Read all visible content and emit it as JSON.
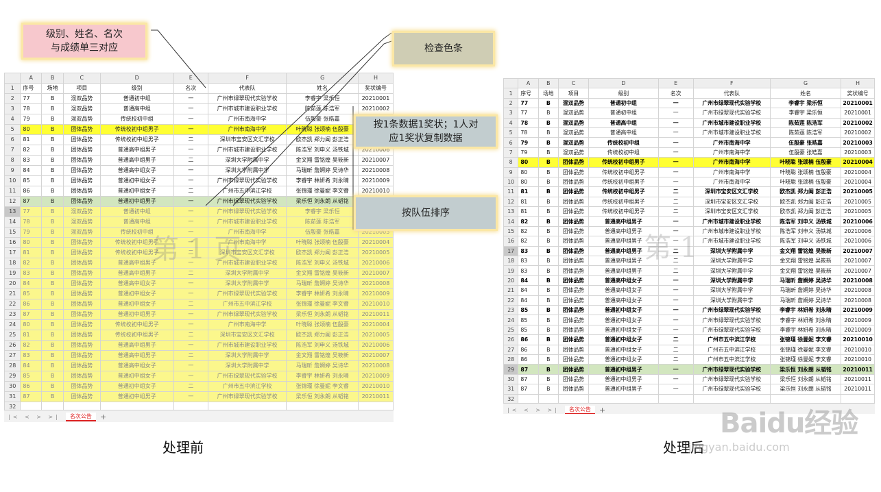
{
  "columns": [
    "A",
    "B",
    "C",
    "D",
    "E",
    "F",
    "G",
    "H"
  ],
  "header_row": [
    "序号",
    "场地",
    "项目",
    "级别",
    "名次",
    "代表队",
    "姓名",
    "奖状编号"
  ],
  "before": {
    "caption": "处理前",
    "sheet_tab": "名次公告",
    "watermark": "第 1 页",
    "rows": [
      {
        "n": "1",
        "c": [
          "序号",
          "场地",
          "项目",
          "级别",
          "名次",
          "代表队",
          "姓名",
          "奖状编号"
        ],
        "s": "hdr"
      },
      {
        "n": "2",
        "c": [
          "77",
          "B",
          "混双品势",
          "普通初中组",
          "一",
          "广州市绿翠现代实验学校",
          "李睿宇 梁乐恒",
          "20210001"
        ],
        "s": ""
      },
      {
        "n": "3",
        "c": [
          "78",
          "B",
          "混双品势",
          "普通高中组",
          "一",
          "广州市城市建设职业学校",
          "陈茹莲 陈浩军",
          "20210002"
        ],
        "s": ""
      },
      {
        "n": "4",
        "c": [
          "79",
          "B",
          "混双品势",
          "传统校初中组",
          "一",
          "广州市南海中学",
          "伍殷豪 张皓嘉",
          "20210003"
        ],
        "s": ""
      },
      {
        "n": "5",
        "c": [
          "80",
          "B",
          "团体品势",
          "传统校初中组男子",
          "一",
          "广州市南海中学",
          "叶晓聪 张颂楠 伍殷豪",
          "20210004"
        ],
        "s": "yellow"
      },
      {
        "n": "6",
        "c": [
          "81",
          "B",
          "团体品势",
          "传统校初中组男子",
          "二",
          "深圳市宝安区文汇学校",
          "欧杰凯 郑力阖 彭正浩",
          "20210005"
        ],
        "s": ""
      },
      {
        "n": "7",
        "c": [
          "82",
          "B",
          "团体品势",
          "普通高中组男子",
          "一",
          "广州市城市建设职业学校",
          "陈浩军 刘申义 汤铁城",
          "20210006"
        ],
        "s": ""
      },
      {
        "n": "8",
        "c": [
          "83",
          "B",
          "团体品势",
          "普通高中组男子",
          "二",
          "深圳大学附属中学",
          "金文翔 雷铭煌 吴筱新",
          "20210007"
        ],
        "s": ""
      },
      {
        "n": "9",
        "c": [
          "84",
          "B",
          "团体品势",
          "普通高中组女子",
          "一",
          "深圳大学附属中学",
          "马瑞昕 詹婀婷 吴诗华",
          "20210008"
        ],
        "s": ""
      },
      {
        "n": "10",
        "c": [
          "85",
          "B",
          "团体品势",
          "普通初中组女子",
          "一",
          "广州市绿翠现代实验学校",
          "李睿宇 林妍希 刘永晴",
          "20210009"
        ],
        "s": ""
      },
      {
        "n": "11",
        "c": [
          "86",
          "B",
          "团体品势",
          "普通初中组女子",
          "二",
          "广州市五中滨江学校",
          "张锦瑾 徐曼妮 李文睿",
          "20210010"
        ],
        "s": ""
      },
      {
        "n": "12",
        "c": [
          "87",
          "B",
          "团体品势",
          "普通初中组男子",
          "一",
          "广州市绿翠现代实验学校",
          "梁乐恒 刘永朗 从韬铭",
          "20210011"
        ],
        "s": "green"
      },
      {
        "n": "13",
        "c": [
          "77",
          "B",
          "混双品势",
          "普通初中组",
          "一",
          "广州市绿翠现代实验学校",
          "李睿宇 梁乐恒",
          "20210001"
        ],
        "s": "faded sel"
      },
      {
        "n": "14",
        "c": [
          "78",
          "B",
          "混双品势",
          "普通高中组",
          "一",
          "广州市城市建设职业学校",
          "陈茹莲 陈浩军",
          "20210002"
        ],
        "s": "faded"
      },
      {
        "n": "15",
        "c": [
          "79",
          "B",
          "混双品势",
          "传统校初中组",
          "一",
          "广州市南海中学",
          "伍殷豪 张皓嘉",
          "20210003"
        ],
        "s": "faded"
      },
      {
        "n": "16",
        "c": [
          "80",
          "B",
          "团体品势",
          "传统校初中组男子",
          "一",
          "广州市南海中学",
          "叶晓聪 张颂楠 伍殷豪",
          "20210004"
        ],
        "s": "faded"
      },
      {
        "n": "17",
        "c": [
          "81",
          "B",
          "团体品势",
          "传统校初中组男子",
          "二",
          "深圳市宝安区文汇学校",
          "欧杰凯 郑力阖 彭正浩",
          "20210005"
        ],
        "s": "faded"
      },
      {
        "n": "18",
        "c": [
          "82",
          "B",
          "团体品势",
          "普通高中组男子",
          "一",
          "广州市城市建设职业学校",
          "陈浩军 刘申义 汤铁城",
          "20210006"
        ],
        "s": "faded"
      },
      {
        "n": "19",
        "c": [
          "83",
          "B",
          "团体品势",
          "普通高中组男子",
          "二",
          "深圳大学附属中学",
          "金文翔 雷铭煌 吴筱新",
          "20210007"
        ],
        "s": "faded"
      },
      {
        "n": "20",
        "c": [
          "84",
          "B",
          "团体品势",
          "普通高中组女子",
          "一",
          "深圳大学附属中学",
          "马瑞昕 詹婀婷 吴诗华",
          "20210008"
        ],
        "s": "faded"
      },
      {
        "n": "21",
        "c": [
          "85",
          "B",
          "团体品势",
          "普通初中组女子",
          "一",
          "广州市绿翠现代实验学校",
          "李睿宇 林妍希 刘永晴",
          "20210009"
        ],
        "s": "faded"
      },
      {
        "n": "22",
        "c": [
          "86",
          "B",
          "团体品势",
          "普通初中组女子",
          "二",
          "广州市五中滨江学校",
          "张锦瑾 徐曼妮 李文睿",
          "20210010"
        ],
        "s": "faded"
      },
      {
        "n": "23",
        "c": [
          "87",
          "B",
          "团体品势",
          "普通初中组男子",
          "一",
          "广州市绿翠现代实验学校",
          "梁乐恒 刘永朗 从韬铭",
          "20210011"
        ],
        "s": "faded"
      },
      {
        "n": "24",
        "c": [
          "80",
          "B",
          "团体品势",
          "传统校初中组男子",
          "一",
          "广州市南海中学",
          "叶晓聪 张颂楠 伍殷豪",
          "20210004"
        ],
        "s": "faded"
      },
      {
        "n": "25",
        "c": [
          "81",
          "B",
          "团体品势",
          "传统校初中组男子",
          "二",
          "深圳市宝安区文汇学校",
          "欧杰凯 郑力阖 彭正浩",
          "20210005"
        ],
        "s": "faded"
      },
      {
        "n": "26",
        "c": [
          "82",
          "B",
          "团体品势",
          "普通高中组男子",
          "一",
          "广州市城市建设职业学校",
          "陈浩军 刘申义 汤铁城",
          "20210006"
        ],
        "s": "faded"
      },
      {
        "n": "27",
        "c": [
          "83",
          "B",
          "团体品势",
          "普通高中组男子",
          "二",
          "深圳大学附属中学",
          "金文翔 雷铭煌 吴筱新",
          "20210007"
        ],
        "s": "faded"
      },
      {
        "n": "28",
        "c": [
          "84",
          "B",
          "团体品势",
          "普通高中组女子",
          "一",
          "深圳大学附属中学",
          "马瑞昕 詹婀婷 吴诗华",
          "20210008"
        ],
        "s": "faded"
      },
      {
        "n": "29",
        "c": [
          "85",
          "B",
          "团体品势",
          "普通初中组女子",
          "一",
          "广州市绿翠现代实验学校",
          "李睿宇 林妍希 刘永晴",
          "20210009"
        ],
        "s": "faded"
      },
      {
        "n": "30",
        "c": [
          "86",
          "B",
          "团体品势",
          "普通初中组女子",
          "二",
          "广州市五中滨江学校",
          "张锦瑾 徐曼妮 李文睿",
          "20210010"
        ],
        "s": "faded"
      },
      {
        "n": "31",
        "c": [
          "87",
          "B",
          "团体品势",
          "普通初中组男子",
          "一",
          "广州市绿翠现代实验学校",
          "梁乐恒 刘永朗 从韬铭",
          "20210011"
        ],
        "s": "faded"
      },
      {
        "n": "32",
        "c": [
          "",
          "",
          "",
          "",
          "",
          "",
          "",
          ""
        ],
        "s": "empty"
      }
    ]
  },
  "after": {
    "caption": "处理后",
    "sheet_tab": "名次公告",
    "watermark": "第 1",
    "rows": [
      {
        "n": "1",
        "c": [
          "序号",
          "场地",
          "项目",
          "级别",
          "名次",
          "代表队",
          "姓名",
          "奖状编号"
        ],
        "s": "hdr"
      },
      {
        "n": "2",
        "c": [
          "77",
          "B",
          "混双品势",
          "普通初中组",
          "一",
          "广州市绿翠现代实验学校",
          "李睿宇 梁乐恒",
          "20210001"
        ],
        "s": "bold"
      },
      {
        "n": "3",
        "c": [
          "77",
          "B",
          "混双品势",
          "普通初中组",
          "一",
          "广州市绿翠现代实验学校",
          "李睿宇 梁乐恒",
          "20210001"
        ],
        "s": ""
      },
      {
        "n": "4",
        "c": [
          "78",
          "B",
          "混双品势",
          "普通高中组",
          "一",
          "广州市城市建设职业学校",
          "陈茹莲 陈浩军",
          "20210002"
        ],
        "s": "bold"
      },
      {
        "n": "5",
        "c": [
          "78",
          "B",
          "混双品势",
          "普通高中组",
          "一",
          "广州市城市建设职业学校",
          "陈茹莲 陈浩军",
          "20210002"
        ],
        "s": ""
      },
      {
        "n": "6",
        "c": [
          "79",
          "B",
          "混双品势",
          "传统校初中组",
          "一",
          "广州市南海中学",
          "伍殷豪 张皓嘉",
          "20210003"
        ],
        "s": "bold"
      },
      {
        "n": "7",
        "c": [
          "79",
          "B",
          "混双品势",
          "传统校初中组",
          "一",
          "广州市南海中学",
          "伍殷豪 张皓嘉",
          "20210003"
        ],
        "s": ""
      },
      {
        "n": "8",
        "c": [
          "80",
          "B",
          "团体品势",
          "传统校初中组男子",
          "一",
          "广州市南海中学",
          "叶晓聪 张颂楠 伍殷豪",
          "20210004"
        ],
        "s": "yellow bold"
      },
      {
        "n": "9",
        "c": [
          "80",
          "B",
          "团体品势",
          "传统校初中组男子",
          "一",
          "广州市南海中学",
          "叶晓聪 张颂楠 伍殷豪",
          "20210004"
        ],
        "s": ""
      },
      {
        "n": "10",
        "c": [
          "80",
          "B",
          "团体品势",
          "传统校初中组男子",
          "一",
          "广州市南海中学",
          "叶晓聪 张颂楠 伍殷豪",
          "20210004"
        ],
        "s": ""
      },
      {
        "n": "11",
        "c": [
          "81",
          "B",
          "团体品势",
          "传统校初中组男子",
          "二",
          "深圳市宝安区文汇学校",
          "欧杰凯 郑力阖 彭正浩",
          "20210005"
        ],
        "s": "bold"
      },
      {
        "n": "12",
        "c": [
          "81",
          "B",
          "团体品势",
          "传统校初中组男子",
          "二",
          "深圳市宝安区文汇学校",
          "欧杰凯 郑力阖 彭正浩",
          "20210005"
        ],
        "s": ""
      },
      {
        "n": "13",
        "c": [
          "81",
          "B",
          "团体品势",
          "传统校初中组男子",
          "二",
          "深圳市宝安区文汇学校",
          "欧杰凯 郑力阖 彭正浩",
          "20210005"
        ],
        "s": ""
      },
      {
        "n": "14",
        "c": [
          "82",
          "B",
          "团体品势",
          "普通高中组男子",
          "一",
          "广州市城市建设职业学校",
          "陈浩军 刘申义 汤铁城",
          "20210006"
        ],
        "s": "bold"
      },
      {
        "n": "15",
        "c": [
          "82",
          "B",
          "团体品势",
          "普通高中组男子",
          "一",
          "广州市城市建设职业学校",
          "陈浩军 刘申义 汤铁城",
          "20210006"
        ],
        "s": ""
      },
      {
        "n": "16",
        "c": [
          "82",
          "B",
          "团体品势",
          "普通高中组男子",
          "一",
          "广州市城市建设职业学校",
          "陈浩军 刘申义 汤铁城",
          "20210006"
        ],
        "s": ""
      },
      {
        "n": "17",
        "c": [
          "83",
          "B",
          "团体品势",
          "普通高中组男子",
          "二",
          "深圳大学附属中学",
          "金文翔 雷铭煌 吴筱新",
          "20210007"
        ],
        "s": "bold sel"
      },
      {
        "n": "18",
        "c": [
          "83",
          "B",
          "团体品势",
          "普通高中组男子",
          "二",
          "深圳大学附属中学",
          "金文翔 雷铭煌 吴筱新",
          "20210007"
        ],
        "s": ""
      },
      {
        "n": "19",
        "c": [
          "83",
          "B",
          "团体品势",
          "普通高中组男子",
          "二",
          "深圳大学附属中学",
          "金文翔 雷铭煌 吴筱新",
          "20210007"
        ],
        "s": ""
      },
      {
        "n": "20",
        "c": [
          "84",
          "B",
          "团体品势",
          "普通高中组女子",
          "一",
          "深圳大学附属中学",
          "马瑞昕 詹婀婷 吴诗华",
          "20210008"
        ],
        "s": "bold"
      },
      {
        "n": "21",
        "c": [
          "84",
          "B",
          "团体品势",
          "普通高中组女子",
          "一",
          "深圳大学附属中学",
          "马瑞昕 詹婀婷 吴诗华",
          "20210008"
        ],
        "s": ""
      },
      {
        "n": "22",
        "c": [
          "84",
          "B",
          "团体品势",
          "普通高中组女子",
          "一",
          "深圳大学附属中学",
          "马瑞昕 詹婀婷 吴诗华",
          "20210008"
        ],
        "s": ""
      },
      {
        "n": "23",
        "c": [
          "85",
          "B",
          "团体品势",
          "普通初中组女子",
          "一",
          "广州市绿翠现代实验学校",
          "李睿宇 林妍希 刘永晴",
          "20210009"
        ],
        "s": "bold"
      },
      {
        "n": "24",
        "c": [
          "85",
          "B",
          "团体品势",
          "普通初中组女子",
          "一",
          "广州市绿翠现代实验学校",
          "李睿宇 林妍希 刘永晴",
          "20210009"
        ],
        "s": ""
      },
      {
        "n": "25",
        "c": [
          "85",
          "B",
          "团体品势",
          "普通初中组女子",
          "一",
          "广州市绿翠现代实验学校",
          "李睿宇 林妍希 刘永晴",
          "20210009"
        ],
        "s": ""
      },
      {
        "n": "26",
        "c": [
          "86",
          "B",
          "团体品势",
          "普通初中组女子",
          "二",
          "广州市五中滨江学校",
          "张锦瑾 徐曼妮 李文睿",
          "20210010"
        ],
        "s": "bold"
      },
      {
        "n": "27",
        "c": [
          "86",
          "B",
          "团体品势",
          "普通初中组女子",
          "二",
          "广州市五中滨江学校",
          "张锦瑾 徐曼妮 李文睿",
          "20210010"
        ],
        "s": ""
      },
      {
        "n": "28",
        "c": [
          "86",
          "B",
          "团体品势",
          "普通初中组女子",
          "二",
          "广州市五中滨江学校",
          "张锦瑾 徐曼妮 李文睿",
          "20210010"
        ],
        "s": ""
      },
      {
        "n": "29",
        "c": [
          "87",
          "B",
          "团体品势",
          "普通初中组男子",
          "一",
          "广州市绿翠现代实验学校",
          "梁乐恒 刘永朗 从韬铭",
          "20210011"
        ],
        "s": "green bold sel"
      },
      {
        "n": "30",
        "c": [
          "87",
          "B",
          "团体品势",
          "普通初中组男子",
          "一",
          "广州市绿翠现代实验学校",
          "梁乐恒 刘永朗 从韬铭",
          "20210011"
        ],
        "s": ""
      },
      {
        "n": "31",
        "c": [
          "87",
          "B",
          "团体品势",
          "普通初中组男子",
          "一",
          "广州市绿翠现代实验学校",
          "梁乐恒 刘永朗 从韬铭",
          "20210011"
        ],
        "s": ""
      },
      {
        "n": "32",
        "c": [
          "",
          "",
          "",
          "",
          "",
          "",
          "",
          ""
        ],
        "s": "empty"
      }
    ]
  },
  "callouts": {
    "match": "级别、姓名、名次\n与成绩单三对应",
    "check_color": "检查色条",
    "copy": "按1条数据1奖状；1人对\n应1奖状复制数据",
    "sort": "按队伍排序"
  },
  "tab_nav": "|< < > >|",
  "watermark_site": {
    "logo": "Baidu经验",
    "url": "jingyan.baidu.com"
  },
  "colors": {
    "highlight_yellow": "#ffff33",
    "highlight_green": "#d2e6bf",
    "faded_yellow": "#fbf78c",
    "border_blue": "#3a56b8"
  }
}
